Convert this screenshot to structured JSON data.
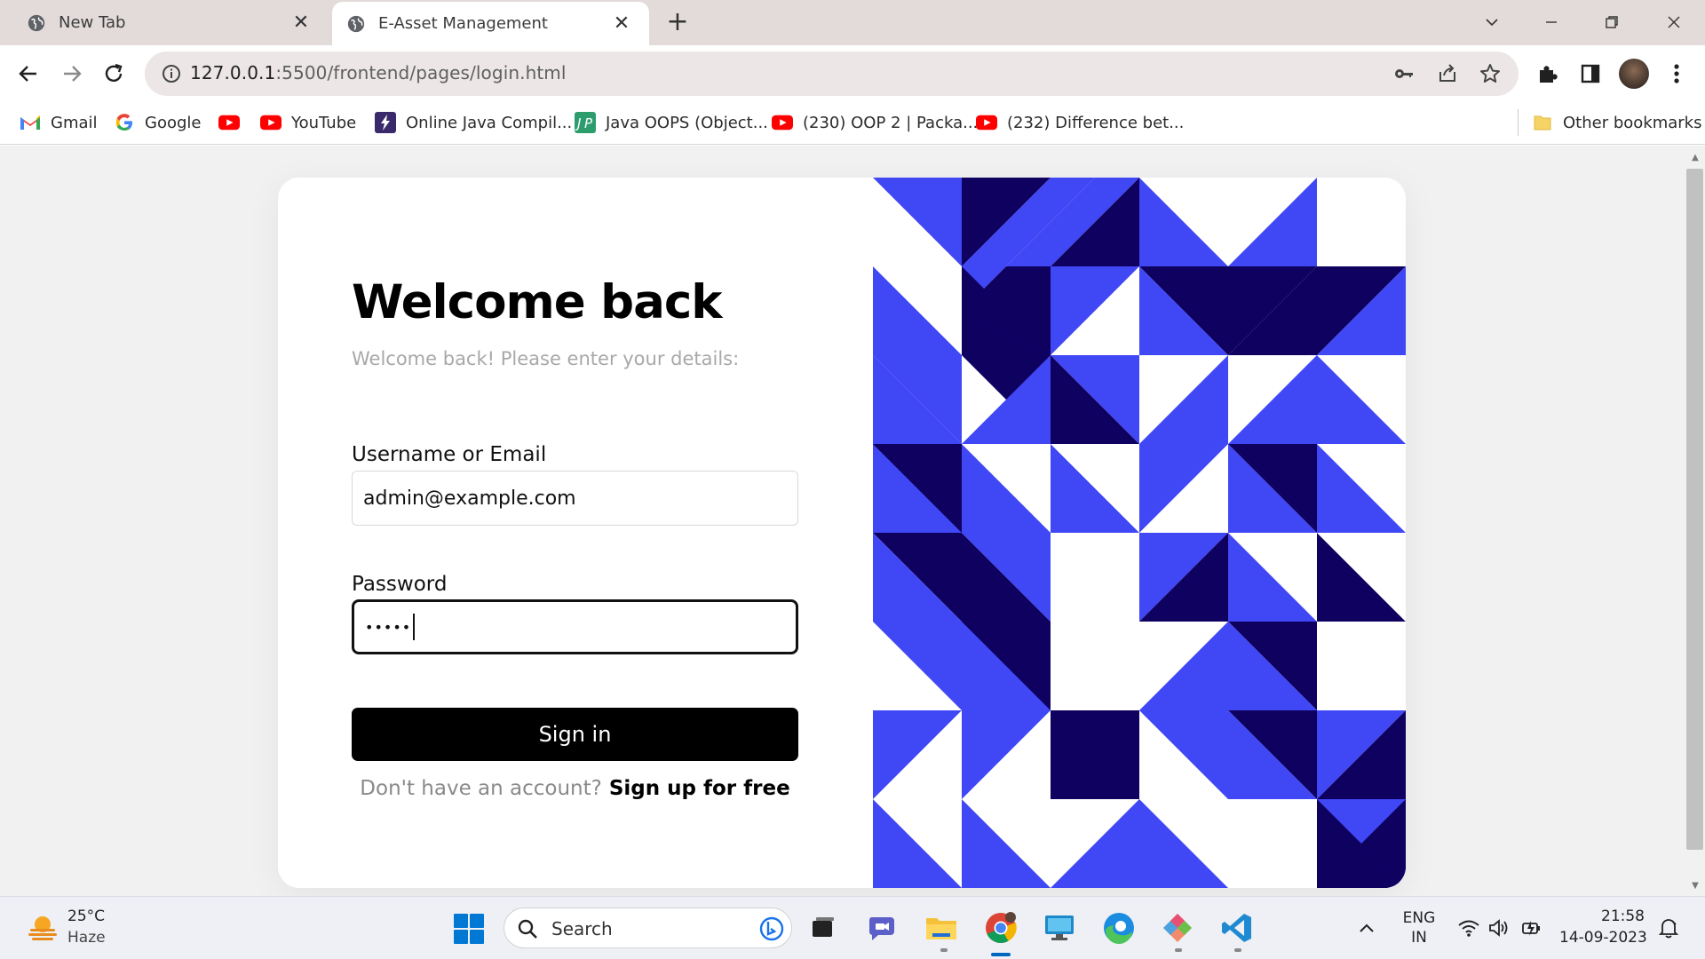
{
  "browser": {
    "tabs": [
      {
        "title": "New Tab",
        "active": false
      },
      {
        "title": "E-Asset Management",
        "active": true
      }
    ],
    "url": {
      "host": "127.0.0.1",
      "path": ":5500/frontend/pages/login.html"
    },
    "bookmarks": [
      {
        "label": "Gmail",
        "icon": "gmail-icon"
      },
      {
        "label": "Google",
        "icon": "google-icon"
      },
      {
        "label": "",
        "icon": "youtube-icon"
      },
      {
        "label": "YouTube",
        "icon": "youtube-icon"
      },
      {
        "label": "Online Java Compil...",
        "icon": "bolt-icon"
      },
      {
        "label": "Java OOPS (Object...",
        "icon": "jp-icon"
      },
      {
        "label": "(230) OOP 2 | Packa...",
        "icon": "youtube-icon"
      },
      {
        "label": "(232) Difference bet...",
        "icon": "youtube-icon"
      }
    ],
    "other_bookmarks": "Other bookmarks"
  },
  "login": {
    "title": "Welcome back",
    "subtitle": "Welcome back! Please enter your details:",
    "username_label": "Username or Email",
    "username_value": "admin@example.com",
    "password_label": "Password",
    "password_value": "•••••",
    "signin_label": "Sign in",
    "signup_prompt": "Don't have an account?",
    "signup_link": "Sign up for free"
  },
  "colors": {
    "pattern_light": "#4047f5",
    "pattern_dark": "#0f0160",
    "pattern_white": "#ffffff",
    "button": "#000000"
  },
  "taskbar": {
    "weather_temp": "25°C",
    "weather_desc": "Haze",
    "search_placeholder": "Search",
    "lang_top": "ENG",
    "lang_bottom": "IN",
    "time": "21:58",
    "date": "14-09-2023"
  }
}
